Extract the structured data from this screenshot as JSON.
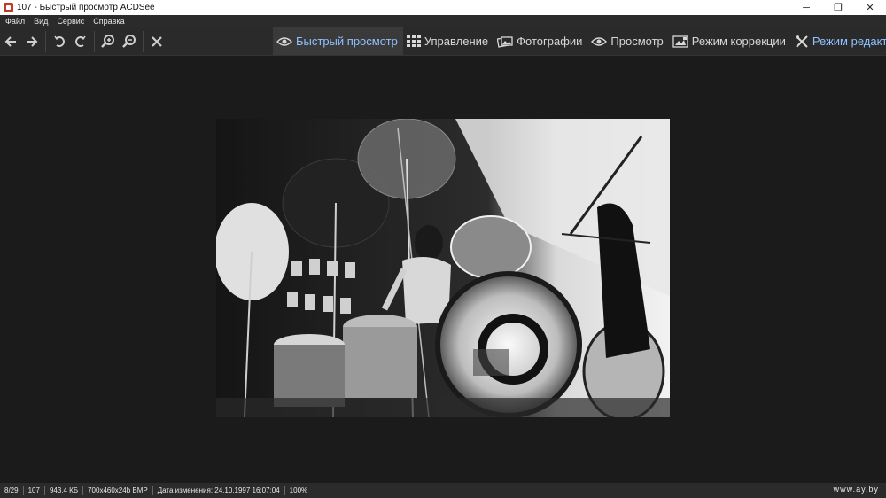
{
  "window": {
    "title": "107 - Быстрый просмотр ACDSee",
    "controls": {
      "minimize": "─",
      "restore": "❐",
      "close": "✕"
    }
  },
  "menubar": {
    "items": [
      {
        "label": "Файл"
      },
      {
        "label": "Вид"
      },
      {
        "label": "Сервис"
      },
      {
        "label": "Справка"
      }
    ]
  },
  "toolbar": {
    "icons": [
      "back-arrow-icon",
      "forward-arrow-icon",
      "rotate-left-icon",
      "rotate-right-icon",
      "zoom-in-icon",
      "zoom-out-icon",
      "close-icon"
    ]
  },
  "modes": {
    "tabs": [
      {
        "label": "Быстрый просмотр",
        "icon": "eye-icon",
        "active": true
      },
      {
        "label": "Управление",
        "icon": "grid-icon",
        "active": false
      },
      {
        "label": "Фотографии",
        "icon": "photos-icon",
        "active": false
      },
      {
        "label": "Просмотр",
        "icon": "eye-icon",
        "active": false
      },
      {
        "label": "Режим коррекции",
        "icon": "develop-icon",
        "active": false
      },
      {
        "label": "Режим редактора",
        "icon": "edit-tools-icon",
        "active": false
      }
    ]
  },
  "status": {
    "position": "8/29",
    "name": "107",
    "filesize": "943.4 КБ",
    "format": "700x460x24b BMP",
    "modified": "Дата изменения: 24.10.1997 16:07:04",
    "zoom": "100%"
  },
  "watermark": "www.ay.by",
  "colors": {
    "background": "#1b1b1b",
    "toolbar": "#2a2a2a",
    "accent": "#8fc1ff",
    "text": "#d8d8d8"
  }
}
